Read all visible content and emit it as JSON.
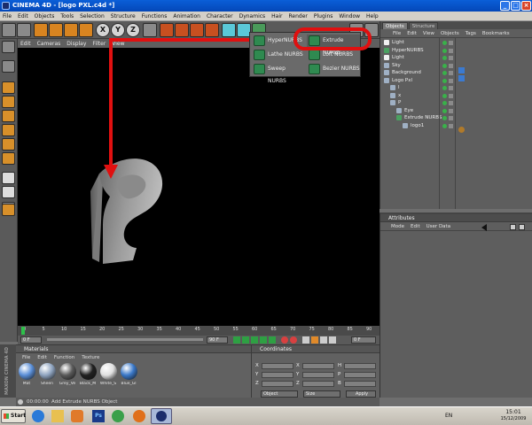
{
  "window": {
    "title": "CINEMA 4D - [logo PXL.c4d *]",
    "minimize": "_",
    "maximize": "□",
    "close": "×"
  },
  "menu": [
    "File",
    "Edit",
    "Objects",
    "Tools",
    "Selection",
    "Structure",
    "Functions",
    "Animation",
    "Character",
    "Dynamics",
    "Hair",
    "Render",
    "Plugins",
    "Window",
    "Help"
  ],
  "toolbar": {
    "axis_x": "X",
    "axis_y": "Y",
    "axis_z": "Z"
  },
  "viewport_menu": [
    "Edit",
    "Cameras",
    "Display",
    "Filter",
    "View"
  ],
  "nurbs_popup": {
    "items": [
      "HyperNURBS",
      "Extrude NURBS",
      "Lathe NURBS",
      "Loft NURBS",
      "Sweep NURBS",
      "Bezier NURBS"
    ]
  },
  "objects_panel": {
    "tabs": [
      "Objects",
      "Structure"
    ],
    "menu": [
      "File",
      "Edit",
      "View",
      "Objects",
      "Tags",
      "Bookmarks"
    ],
    "rows": [
      {
        "name": "Light",
        "indent": 0
      },
      {
        "name": "HyperNURBS",
        "indent": 0
      },
      {
        "name": "Light",
        "indent": 0
      },
      {
        "name": "Sky",
        "indent": 0
      },
      {
        "name": "Background",
        "indent": 0
      },
      {
        "name": "Logo Pxl",
        "indent": 0
      },
      {
        "name": "l",
        "indent": 1
      },
      {
        "name": "x",
        "indent": 1
      },
      {
        "name": "P",
        "indent": 1
      },
      {
        "name": "Eye",
        "indent": 2
      },
      {
        "name": "Extrude NURBS",
        "indent": 2
      },
      {
        "name": "logo1",
        "indent": 3
      }
    ]
  },
  "attributes_panel": {
    "title": "Attributes",
    "menu": [
      "Mode",
      "Edit",
      "User Data"
    ]
  },
  "timeline": {
    "ticks": [
      "0",
      "5",
      "10",
      "15",
      "20",
      "25",
      "30",
      "35",
      "40",
      "45",
      "50",
      "55",
      "60",
      "65",
      "70",
      "75",
      "80",
      "85",
      "90"
    ],
    "start": "0 F",
    "end": "90 F",
    "current": "0 F"
  },
  "materials": {
    "title": "Materials",
    "menu": [
      "File",
      "Edit",
      "Function",
      "Texture"
    ],
    "items": [
      {
        "name": "Mat",
        "color": "#5b8fd8"
      },
      {
        "name": "Sheen",
        "color": "#8fa4c0"
      },
      {
        "name": "Grey_Ve",
        "color": "#5a5a5a"
      },
      {
        "name": "Black_M",
        "color": "#202020"
      },
      {
        "name": "White_S",
        "color": "#e0e0e0"
      },
      {
        "name": "Blue_Gl",
        "color": "#3a78c8"
      }
    ]
  },
  "coordinates": {
    "title": "Coordinates",
    "rows": [
      {
        "axis": "X",
        "rot": "H"
      },
      {
        "axis": "Y",
        "rot": "P"
      },
      {
        "axis": "Z",
        "rot": "B"
      }
    ],
    "mode_select": "Object",
    "size_select": "Size",
    "apply_label": "Apply"
  },
  "status": {
    "time": "00:00:00",
    "message": "Add Extrude NURBS Object"
  },
  "taskbar": {
    "start_label": "Start",
    "lang": "EN",
    "clock_time": "15:01",
    "clock_date": "15/12/2009"
  },
  "brand": {
    "side_logo": "MAXON CINEMA 4D"
  },
  "colors": {
    "highlight": "#e01010",
    "accent_green": "#2f8a50",
    "titlebar": "#0a5fd8"
  }
}
